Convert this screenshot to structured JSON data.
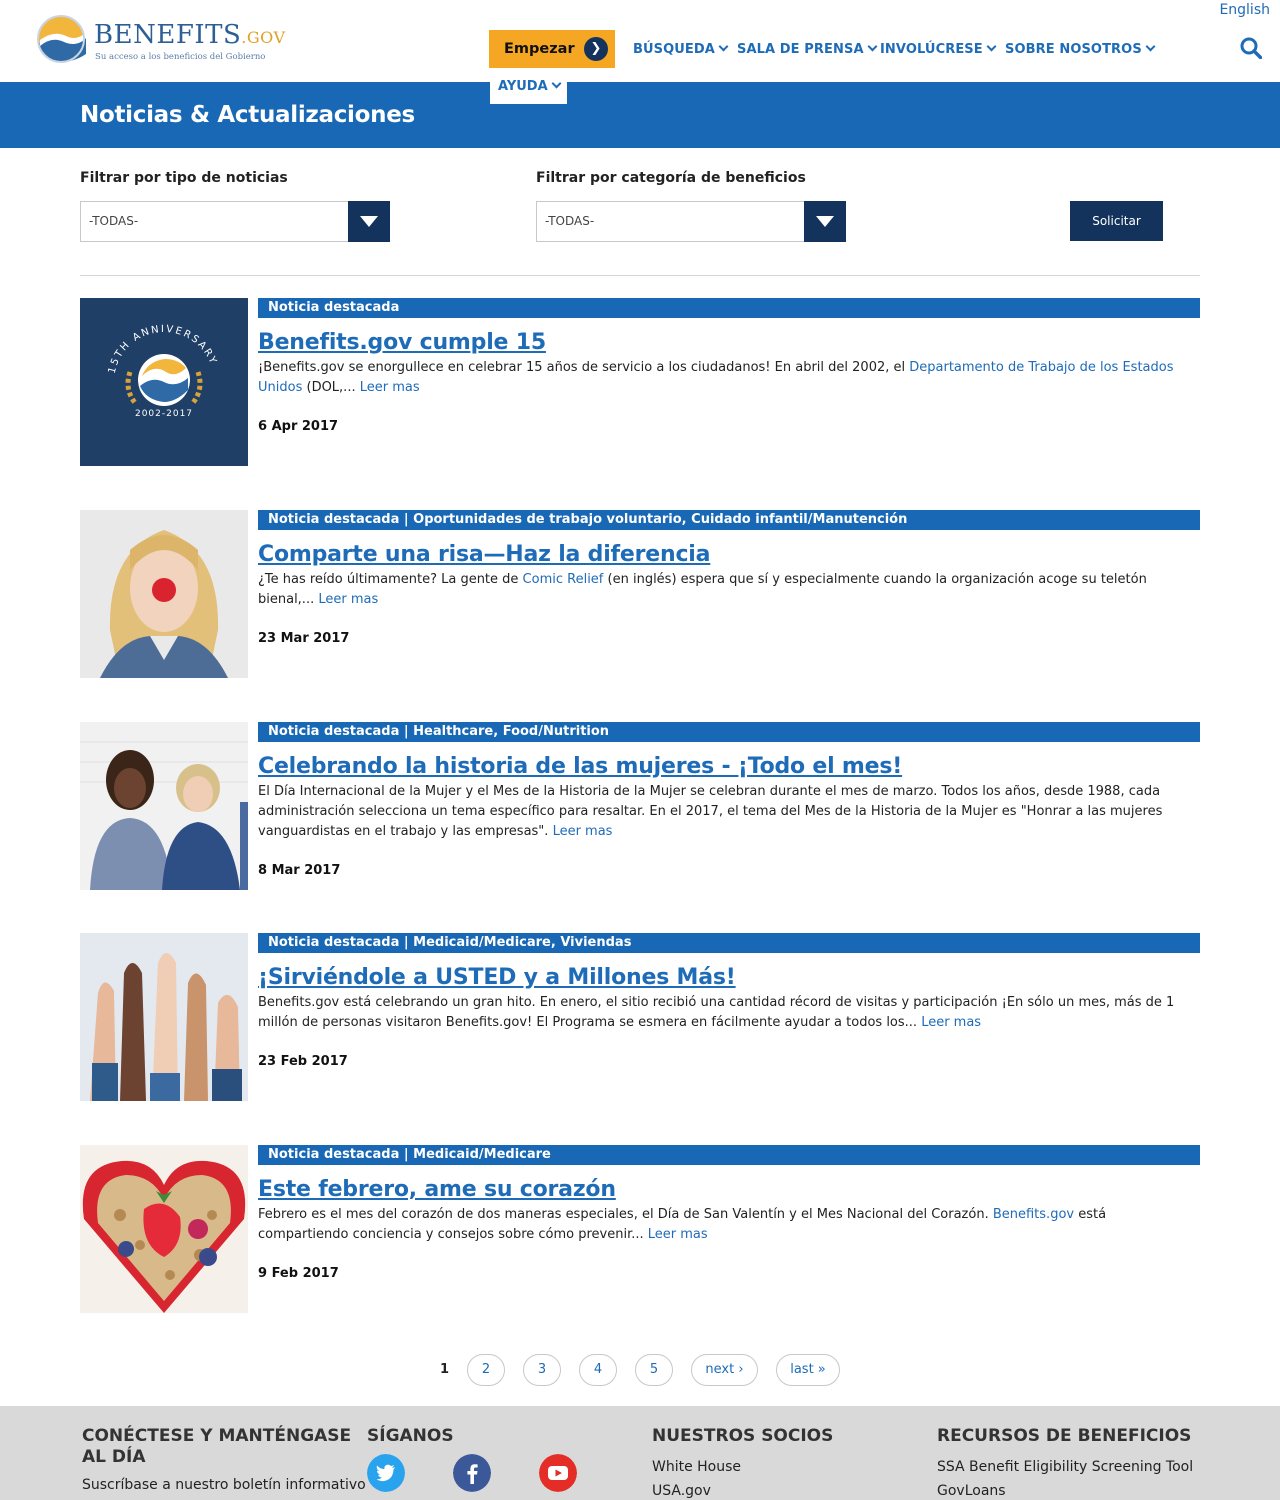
{
  "header": {
    "logo_word": "BENEFITS",
    "logo_gov": ".GOV",
    "logo_tagline": "Su acceso a los beneficios del Gobierno",
    "language_link": "English",
    "start_button": "Empezar",
    "nav": [
      "BÚSQUEDA",
      "SALA DE PRENSA",
      "INVOLÚCRESE",
      "SOBRE NOSOTROS",
      "AYUDA"
    ]
  },
  "page": {
    "title": "Noticias & Actualizaciones"
  },
  "filters": {
    "news_type_label": "Filtrar por tipo de noticias",
    "news_type_value": "-TODAS-",
    "category_label": "Filtrar por categoría de beneficios",
    "category_value": "-TODAS-",
    "apply_button": "Solicitar"
  },
  "articles": [
    {
      "tags": "Noticia destacada",
      "title": "Benefits.gov cumple 15",
      "body_start": "¡Benefits.gov se enorgullece en celebrar 15 años de servicio a los ciudadanos! En abril del 2002, el ",
      "link_text": "Departamento de Trabajo de los Estados Unidos",
      "body_end": " (DOL,... ",
      "read_more": "Leer mas",
      "date": "6 Apr 2017",
      "image_text_top": "15TH ANNIVERSARY",
      "image_text_bottom": "2002-2017"
    },
    {
      "tags": "Noticia destacada | Oportunidades de trabajo voluntario, Cuidado infantil/Manutención",
      "title": "Comparte una risa—Haz la diferencia",
      "body_start": "¿Te has reído últimamente? La gente de ",
      "link_text": "Comic Relief",
      "body_end": " (en inglés) espera que sí y especialmente cuando la organización acoge su teletón bienal,... ",
      "read_more": "Leer mas",
      "date": "23 Mar 2017"
    },
    {
      "tags": "Noticia destacada | Healthcare, Food/Nutrition",
      "title": "Celebrando la historia de las mujeres - ¡Todo el mes!",
      "body_start": "El Día Internacional de la Mujer y el Mes de la Historia de la Mujer se celebran durante el mes de marzo. Todos los años, desde 1988, cada administración selecciona un tema específico para resaltar. En el 2017, el tema del Mes de la Historia de la Mujer es \"Honrar a las mujeres vanguardistas en el trabajo y las empresas\". ",
      "link_text": "",
      "body_end": "",
      "read_more": "Leer mas",
      "date": "8 Mar 2017"
    },
    {
      "tags": "Noticia destacada | Medicaid/Medicare, Viviendas",
      "title": "¡Sirviéndole a USTED y a Millones Más!",
      "body_start": "Benefits.gov está celebrando un gran hito. En enero, el sitio recibió una cantidad récord de visitas y participación ¡En sólo un mes, más de 1 millón de personas visitaron Benefits.gov! El Programa se esmera en fácilmente ayudar a todos los... ",
      "link_text": "",
      "body_end": "",
      "read_more": "Leer mas",
      "date": "23 Feb 2017"
    },
    {
      "tags": "Noticia destacada | Medicaid/Medicare",
      "title": "Este febrero, ame su corazón",
      "body_start": "Febrero es el mes del corazón de dos maneras especiales, el Día de San Valentín y el Mes Nacional del Corazón. ",
      "link_text": "Benefits.gov",
      "body_end": " está compartiendo conciencia y consejos sobre cómo prevenir... ",
      "read_more": "Leer mas",
      "date": "9 Feb 2017"
    }
  ],
  "pagination": {
    "current": "1",
    "pages": [
      "2",
      "3",
      "4",
      "5"
    ],
    "next": "next ›",
    "last": "last »"
  },
  "footer": {
    "col1_title": "CONÉCTESE Y MANTÉNGASE AL DÍA",
    "col1_text": "Suscríbase a nuestro boletín informativo",
    "col2_title": "SÍGANOS",
    "col3_title": "NUESTROS SOCIOS",
    "col3_links": [
      "White House",
      "USA.gov"
    ],
    "col4_title": "RECURSOS DE BENEFICIOS",
    "col4_links": [
      "SSA Benefit Eligibility Screening Tool",
      "GovLoans"
    ]
  },
  "colors": {
    "primary_blue": "#1868b5",
    "navy": "#13335c",
    "orange": "#f5a623",
    "link": "#1e6bb8"
  },
  "icons": [
    "logo-emblem",
    "arrow-right-icon",
    "chevron-down-icon",
    "search-icon",
    "twitter-icon",
    "facebook-icon",
    "youtube-icon"
  ]
}
